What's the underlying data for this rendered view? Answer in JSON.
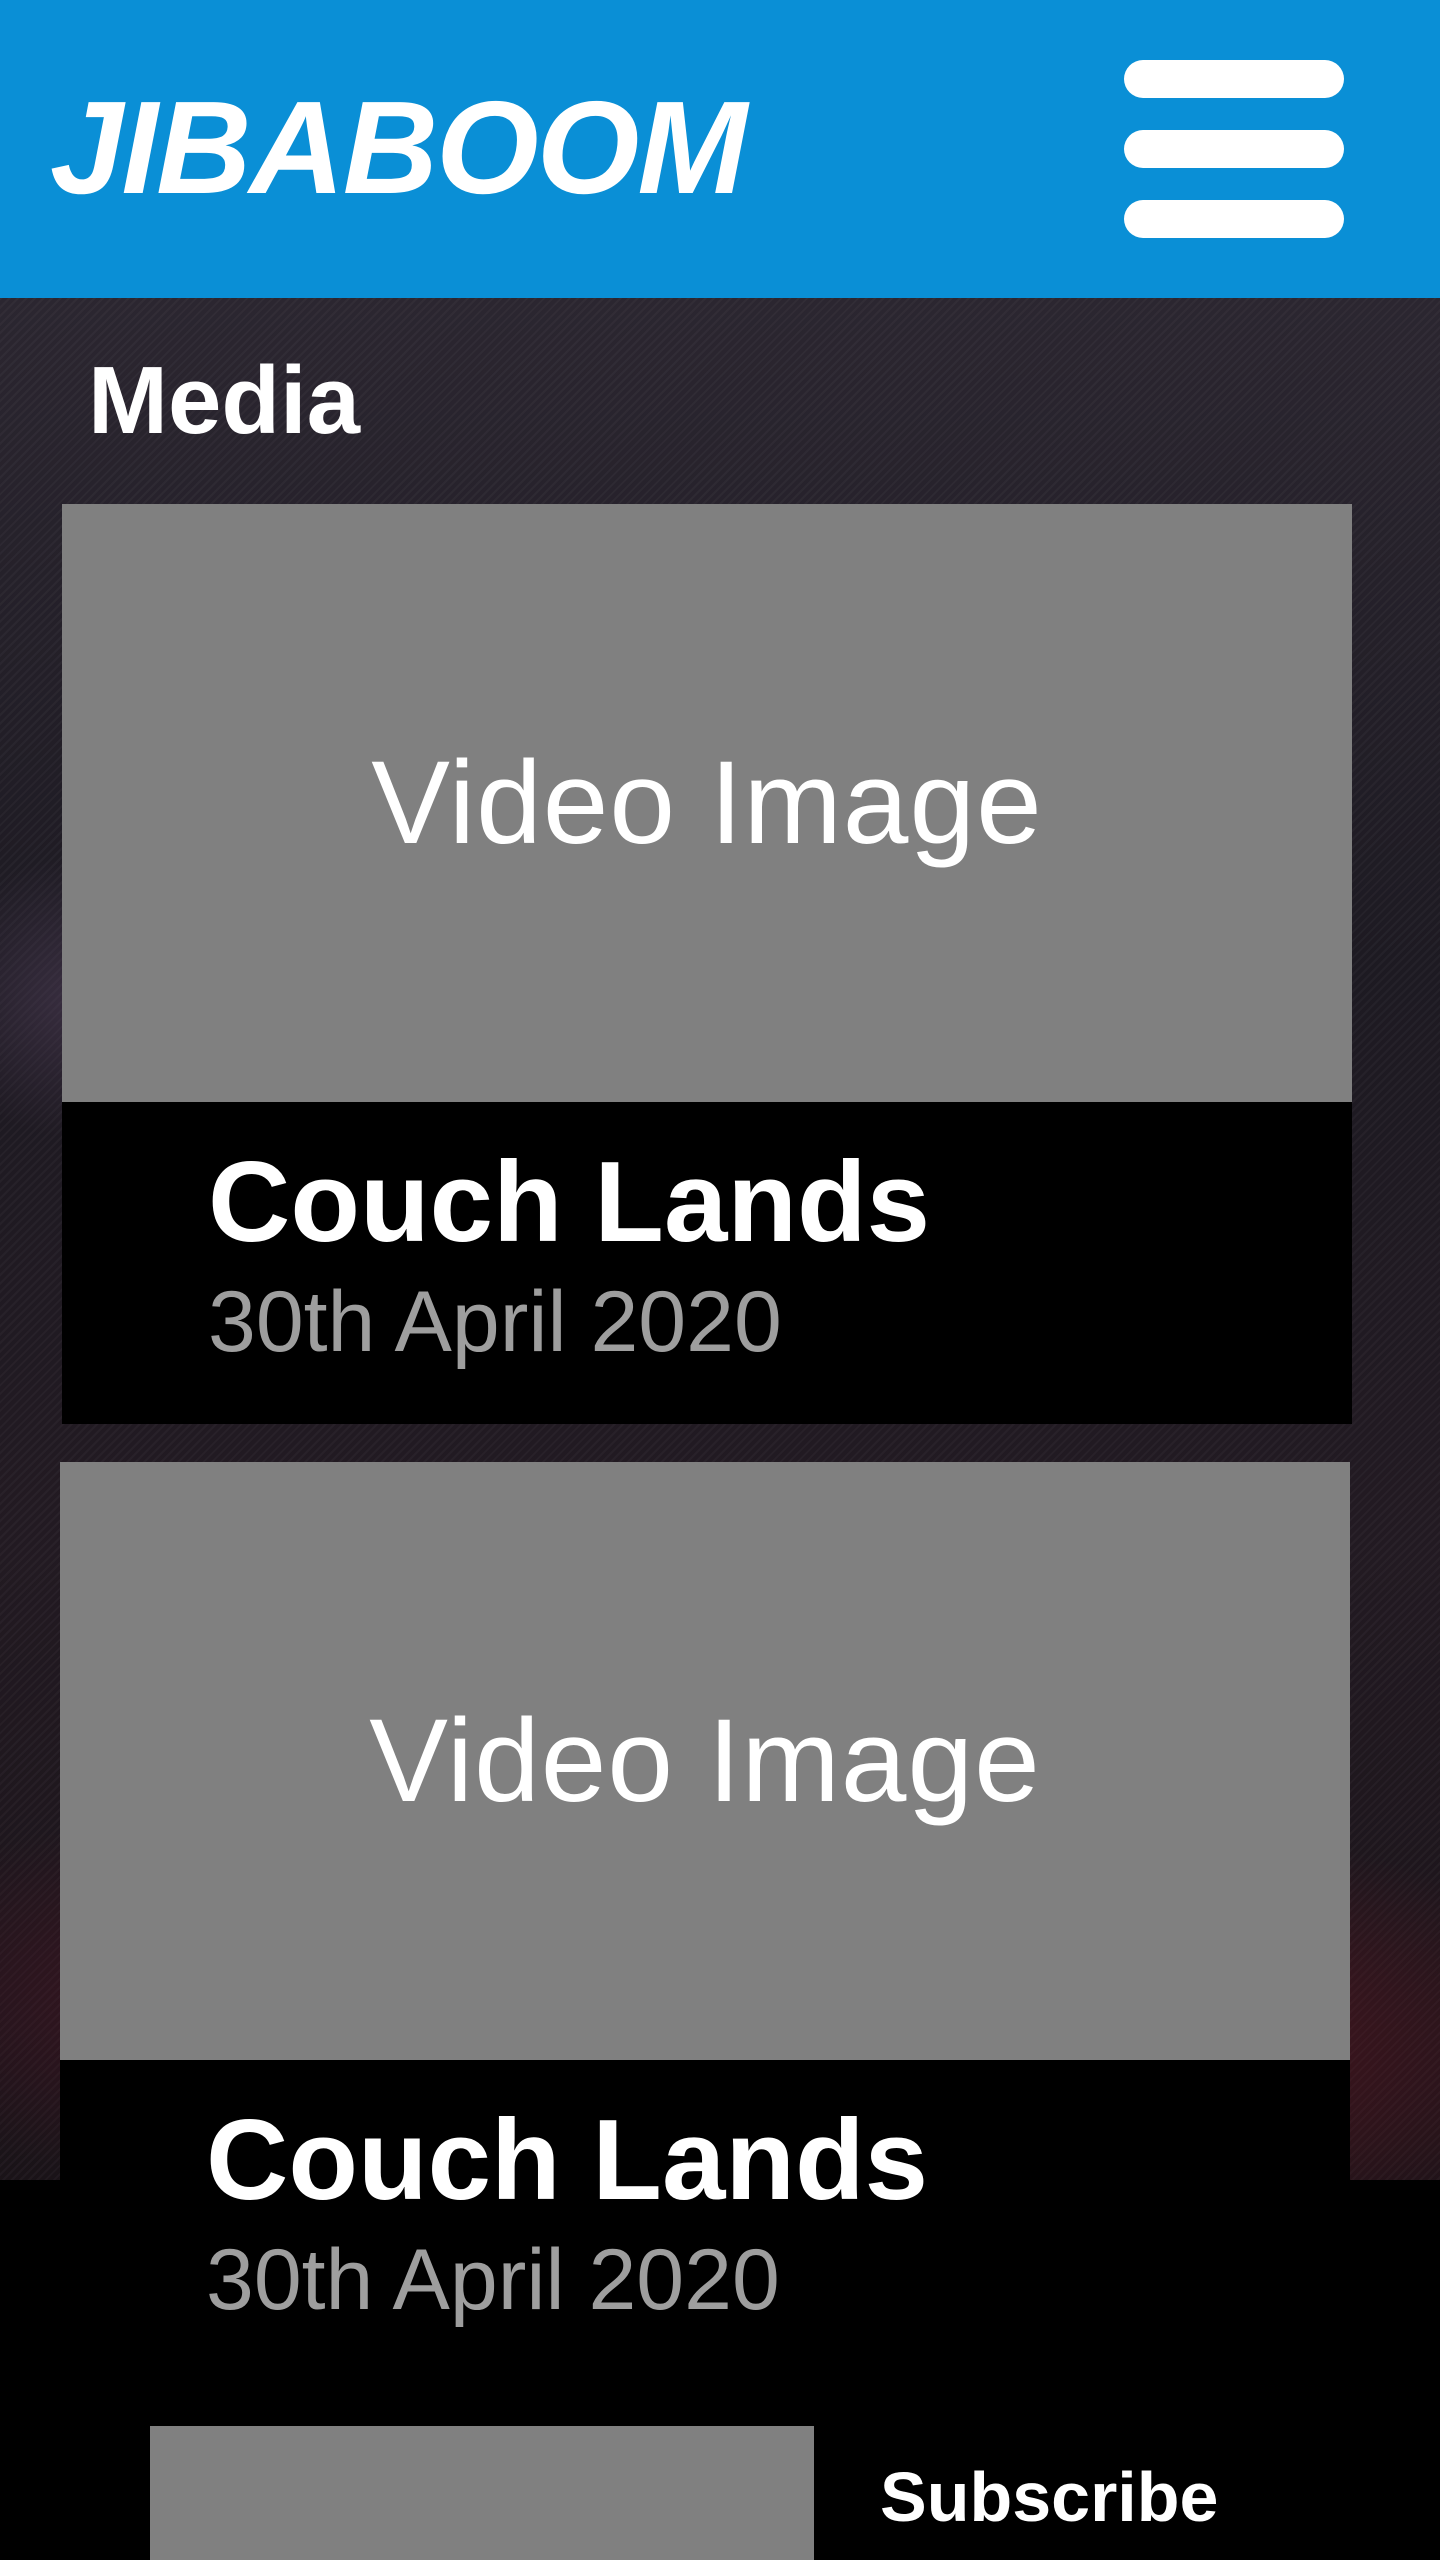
{
  "header": {
    "logo": "JIBABOOM",
    "menu_icon": "hamburger-menu-icon"
  },
  "section": {
    "title": "Media"
  },
  "media": [
    {
      "thumb_label": "Video Image",
      "title": "Couch Lands",
      "date": "30th April 2020"
    },
    {
      "thumb_label": "Video Image",
      "title": "Couch Lands",
      "date": "30th April 2020"
    }
  ],
  "footer": {
    "subscribe_label": "Subscribe"
  },
  "colors": {
    "header": "#0a8fd6",
    "thumb": "#808080",
    "card_info": "#000000",
    "date_text": "#9e9e9e"
  }
}
